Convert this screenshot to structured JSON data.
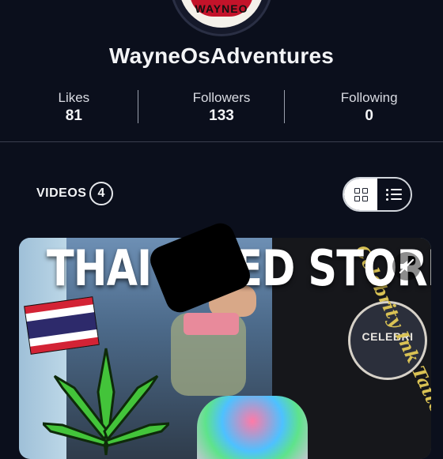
{
  "profile": {
    "avatar_text": "WAYNEO",
    "username": "WayneOsAdventures"
  },
  "stats": [
    {
      "label": "Likes",
      "value": "81"
    },
    {
      "label": "Followers",
      "value": "133"
    },
    {
      "label": "Following",
      "value": "0"
    }
  ],
  "videos": {
    "label": "VIDEOS",
    "count": "4"
  },
  "view_toggle": {
    "grid_icon": "grid-icon",
    "list_icon": "list-icon",
    "active": "grid"
  },
  "video_card": {
    "title_overlay": "THAI WEED STORE",
    "badge_text": "CELEBRI",
    "script_text": "Celebrity Ink Tattoo",
    "mute_icon": "muted-speaker-icon"
  },
  "colors": {
    "background": "#0b0f1c",
    "text": "#f3f4f6",
    "divider": "#9aa0ad"
  }
}
